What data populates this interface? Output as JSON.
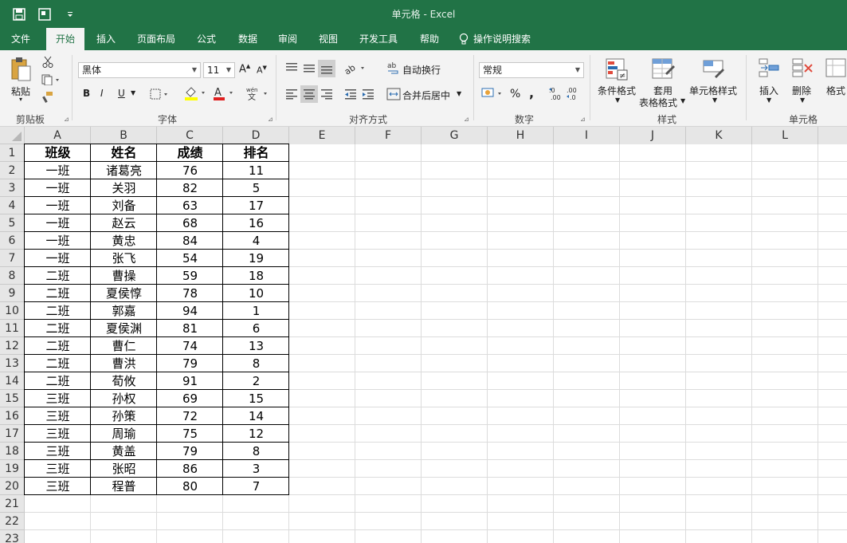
{
  "window": {
    "title": "单元格  -  Excel"
  },
  "quick_access": [
    "save-icon",
    "touch-mode-icon",
    "customize-icon"
  ],
  "tabs": [
    {
      "label": "文件",
      "active": false
    },
    {
      "label": "开始",
      "active": true
    },
    {
      "label": "插入",
      "active": false
    },
    {
      "label": "页面布局",
      "active": false
    },
    {
      "label": "公式",
      "active": false
    },
    {
      "label": "数据",
      "active": false
    },
    {
      "label": "审阅",
      "active": false
    },
    {
      "label": "视图",
      "active": false
    },
    {
      "label": "开发工具",
      "active": false
    },
    {
      "label": "帮助",
      "active": false
    }
  ],
  "tell_me": "操作说明搜索",
  "ribbon": {
    "clipboard": {
      "paste": "粘贴",
      "label": "剪贴板"
    },
    "font": {
      "name": "黑体",
      "size": "11",
      "bold": "B",
      "italic": "I",
      "underline": "U",
      "label": "字体"
    },
    "alignment": {
      "wrap": "自动换行",
      "merge": "合并后居中",
      "label": "对齐方式"
    },
    "number": {
      "format": "常规",
      "percent": "%",
      "comma": ",",
      "label": "数字"
    },
    "styles": {
      "conditional": "条件格式",
      "table_line1": "套用",
      "table_line2": "表格格式",
      "cell_styles": "单元格样式",
      "label": "样式"
    },
    "cells": {
      "insert": "插入",
      "delete": "删除",
      "format": "格式",
      "label": "单元格"
    }
  },
  "columns": [
    "A",
    "B",
    "C",
    "D",
    "E",
    "F",
    "G",
    "H",
    "I",
    "J",
    "K",
    "L"
  ],
  "rows": [
    "1",
    "2",
    "3",
    "4",
    "5",
    "6",
    "7",
    "8",
    "9",
    "10",
    "11",
    "12",
    "13",
    "14",
    "15",
    "16",
    "17",
    "18",
    "19",
    "20",
    "21",
    "22",
    "23"
  ],
  "table": {
    "headers": [
      "班级",
      "姓名",
      "成绩",
      "排名"
    ],
    "rows": [
      [
        "一班",
        "诸葛亮",
        "76",
        "11"
      ],
      [
        "一班",
        "关羽",
        "82",
        "5"
      ],
      [
        "一班",
        "刘备",
        "63",
        "17"
      ],
      [
        "一班",
        "赵云",
        "68",
        "16"
      ],
      [
        "一班",
        "黄忠",
        "84",
        "4"
      ],
      [
        "一班",
        "张飞",
        "54",
        "19"
      ],
      [
        "二班",
        "曹操",
        "59",
        "18"
      ],
      [
        "二班",
        "夏侯惇",
        "78",
        "10"
      ],
      [
        "二班",
        "郭嘉",
        "94",
        "1"
      ],
      [
        "二班",
        "夏侯渊",
        "81",
        "6"
      ],
      [
        "二班",
        "曹仁",
        "74",
        "13"
      ],
      [
        "二班",
        "曹洪",
        "79",
        "8"
      ],
      [
        "二班",
        "荀攸",
        "91",
        "2"
      ],
      [
        "三班",
        "孙权",
        "69",
        "15"
      ],
      [
        "三班",
        "孙策",
        "72",
        "14"
      ],
      [
        "三班",
        "周瑜",
        "75",
        "12"
      ],
      [
        "三班",
        "黄盖",
        "79",
        "8"
      ],
      [
        "三班",
        "张昭",
        "86",
        "3"
      ],
      [
        "三班",
        "程普",
        "80",
        "7"
      ]
    ]
  },
  "colors": {
    "accent": "#217346",
    "ribbon_bg": "#f3f3f3",
    "header_bg": "#e6e6e6"
  }
}
